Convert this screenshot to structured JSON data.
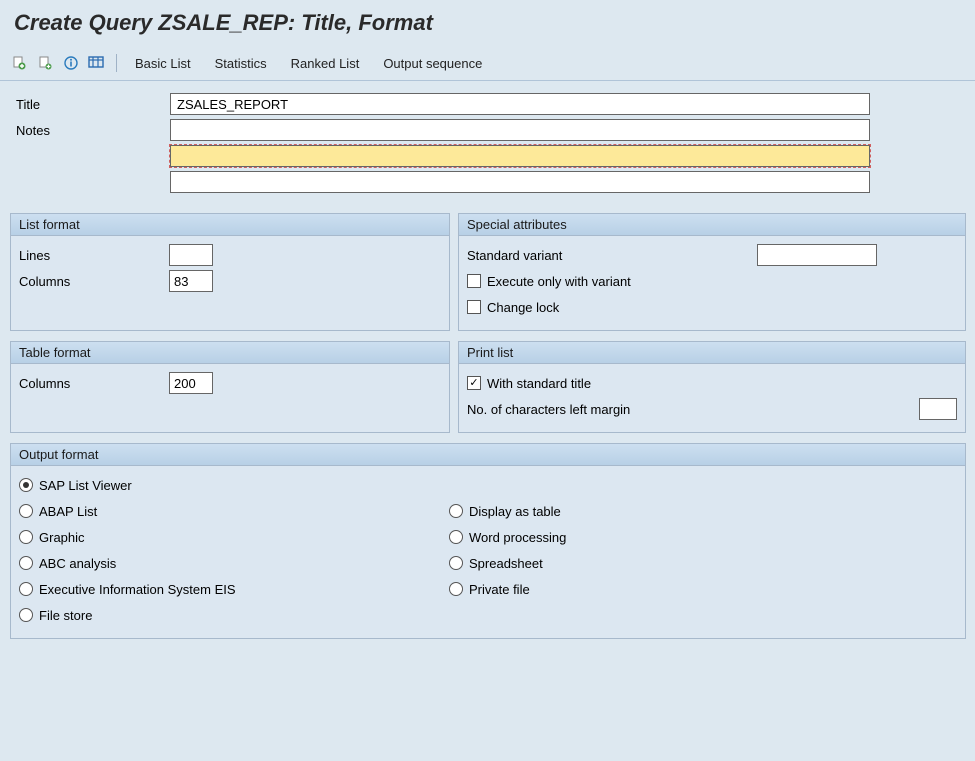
{
  "page_title": "Create Query ZSALE_REP: Title, Format",
  "toolbar": {
    "basic_list": "Basic List",
    "statistics": "Statistics",
    "ranked_list": "Ranked List",
    "output_sequence": "Output sequence"
  },
  "form": {
    "title_label": "Title",
    "title_value": "ZSALES_REPORT",
    "notes_label": "Notes",
    "notes_value1": "",
    "notes_value2": "",
    "notes_value3": ""
  },
  "list_format": {
    "header": "List format",
    "lines_label": "Lines",
    "lines_value": "",
    "columns_label": "Columns",
    "columns_value": "83"
  },
  "special_attributes": {
    "header": "Special attributes",
    "std_variant_label": "Standard variant",
    "std_variant_value": "",
    "exec_only_label": "Execute only with variant",
    "exec_only_checked": false,
    "change_lock_label": "Change lock",
    "change_lock_checked": false
  },
  "table_format": {
    "header": "Table format",
    "columns_label": "Columns",
    "columns_value": "200"
  },
  "print_list": {
    "header": "Print list",
    "with_std_title_label": "With standard title",
    "with_std_title_checked": true,
    "left_margin_label": "No. of characters left margin",
    "left_margin_value": ""
  },
  "output_format": {
    "header": "Output format",
    "options_left": [
      {
        "label": "SAP List Viewer",
        "checked": true
      },
      {
        "label": "ABAP List",
        "checked": false
      },
      {
        "label": "Graphic",
        "checked": false
      },
      {
        "label": "ABC analysis",
        "checked": false
      },
      {
        "label": "Executive Information System EIS",
        "checked": false
      },
      {
        "label": "File store",
        "checked": false
      }
    ],
    "options_right": [
      {
        "label": "Display as table",
        "checked": false
      },
      {
        "label": "Word processing",
        "checked": false
      },
      {
        "label": "Spreadsheet",
        "checked": false
      },
      {
        "label": "Private file",
        "checked": false
      }
    ]
  }
}
